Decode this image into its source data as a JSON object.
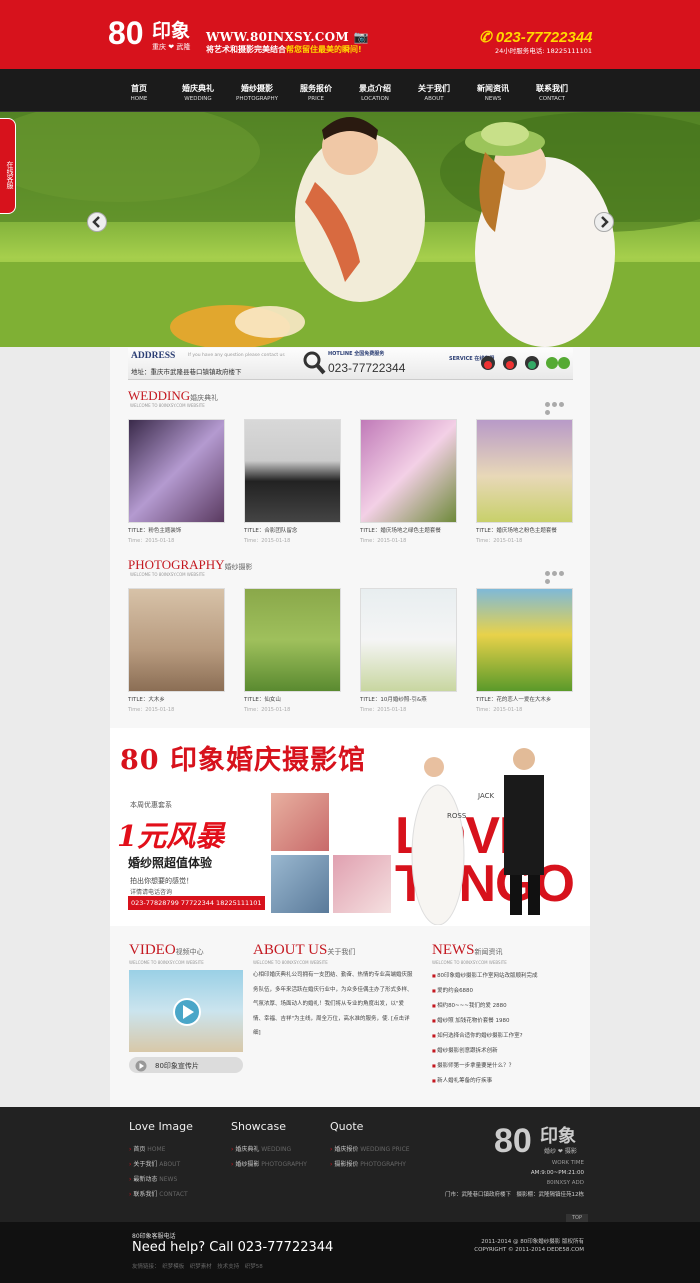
{
  "header": {
    "logo_text": "印象",
    "logo_sub": "重庆 ❤ 武隆",
    "url": "WWW.80INXSY.COM",
    "slogan_a": "将艺术和摄影完美结合",
    "slogan_b": "帮您留住最美的瞬间!",
    "phone": "023-77722344",
    "phone_sub": "24小时服务电话: 18225111101"
  },
  "nav": [
    {
      "cn": "首页",
      "en": "HOME"
    },
    {
      "cn": "婚庆典礼",
      "en": "WEDDING"
    },
    {
      "cn": "婚纱摄影",
      "en": "PHOTOGRAPHY"
    },
    {
      "cn": "服务报价",
      "en": "PRICE"
    },
    {
      "cn": "景点介绍",
      "en": "LOCATION"
    },
    {
      "cn": "关于我们",
      "en": "ABOUT"
    },
    {
      "cn": "新闻资讯",
      "en": "NEWS"
    },
    {
      "cn": "联系我们",
      "en": "CONTACT"
    }
  ],
  "side_tab": "在线客服",
  "address": {
    "title": "ADDRESS",
    "sub": "If you have any question please contact us",
    "line": "地址：重庆市武隆县巷口镇镇政府楼下",
    "hotline_label": "HOTLINE 全国免费服务",
    "hotline": "023-77722344",
    "service_label": "SERVICE 在线客服"
  },
  "wedding": {
    "title": "WEDDING",
    "title_cn": "婚庆典礼",
    "sub": "WELCOME TO 80INXSY.COM WEBSITE",
    "items": [
      {
        "title": "TITLE：粉色主题装饰",
        "time": "Time：2015-01-18"
      },
      {
        "title": "TITLE：合影团队留念",
        "time": "Time：2015-01-18"
      },
      {
        "title": "TITLE：婚庆场地之绿色主题套餐",
        "time": "Time：2015-01-18"
      },
      {
        "title": "TITLE：婚庆场地之粉色主题套餐",
        "time": "Time：2015-01-18"
      }
    ]
  },
  "photography": {
    "title": "PHOTOGRAPHY",
    "title_cn": "婚纱摄影",
    "sub": "WELCOME TO 80INXSY.COM WEBSITE",
    "items": [
      {
        "title": "TITLE：大木乡",
        "time": "Time：2015-01-18"
      },
      {
        "title": "TITLE：仙女山",
        "time": "Time：2015-01-18"
      },
      {
        "title": "TITLE：10月婚纱照-引&燕",
        "time": "Time：2015-01-18"
      },
      {
        "title": "TITLE：花的恋人一爱在大木乡",
        "time": "Time：2015-01-18"
      }
    ]
  },
  "ad": {
    "title": "80 印象婚庆摄影馆",
    "week": "本周优惠套系",
    "big": "1元风暴",
    "exp": "婚纱照超值体验",
    "feel": "拍出你想要的感觉！",
    "call": "详情请电话咨询",
    "tel": "023-77828799  77722344  18225111101",
    "lovetango": "LOVE TANGO",
    "jack": "JACK",
    "ross": "ROSS"
  },
  "video": {
    "title": "VIDEO",
    "title_cn": "视频中心",
    "sub": "WELCOME TO 80INXSY.COM WEBSITE",
    "button": "80印象宣传片"
  },
  "about": {
    "title": "ABOUT US",
    "title_cn": "关于我们",
    "sub": "WELCOME TO 80INXSY.COM WEBSITE",
    "text": "心相印婚庆典礼公司拥有一支团结、勤奋、热情的专业高端婚庆服务队伍，多年来活跃在婚庆行业中，为众多佳偶主办了形式多样、气氛浓厚、场面动人的婚礼！我们将从专业的角度出发，以\"爱情、幸福、吉祥\"为主线，周全万位，高水准的服务，使. [点击详细]"
  },
  "news": {
    "title": "NEWS",
    "title_cn": "新闻资讯",
    "sub": "WELCOME TO 80INXSY.COM WEBSITE",
    "items": [
      "80印象婚纱摄影工作室网站改版顺利完成",
      "爱的约会6880",
      "相约80~~~我们的爱 2880",
      "婚纱照 加钱花物价套餐 1980",
      "如何选择合适你的婚纱摄影工作室?",
      "婚纱摄影创意跟拆术创新",
      "摄影师第一步拿量要是什么？？",
      "新人婚礼筹备的疗疾事"
    ]
  },
  "footer": {
    "col1_title": "Love Image",
    "col1": [
      {
        "cn": "首页",
        "en": "HOME"
      },
      {
        "cn": "关于我们",
        "en": "ABOUT"
      },
      {
        "cn": "最新动态",
        "en": "NEWS"
      },
      {
        "cn": "联系我们",
        "en": "CONTACT"
      }
    ],
    "col2_title": "Showcase",
    "col2": [
      {
        "cn": "婚庆典礼",
        "en": "WEDDING"
      },
      {
        "cn": "婚纱摄影",
        "en": "PHOTOGRAPHY"
      }
    ],
    "col3_title": "Quote",
    "col3": [
      {
        "cn": "婚庆报价",
        "en": "WEDDING PRICE"
      },
      {
        "cn": "摄影报价",
        "en": "PHOTOGRAPHY"
      }
    ],
    "logo_text": "印象",
    "logo_sub": "婚纱 ❤ 摄影",
    "work_time": "WORK TIME",
    "hours": "AM:9:00~PM:21:00",
    "add_label": "80INXSY ADD",
    "store": "门市：武隆巷口镇政府楼下　摄影棚：武隆隔镇佳苑12栋",
    "top": "TOP"
  },
  "bottom": {
    "hotline_label": "80印象客服电话",
    "needhelp": "Need help?  Call 023-77722344",
    "links": "友情链接：　织梦模板　织梦素材　技术支持　织梦58",
    "copyright1": "2011-2014 @ 80印象婚纱摄影 版权所有",
    "copyright2": "COPYRIGHT © 2011-2014 DEDE58.COM"
  },
  "colors": {
    "brand_red": "#d7121c",
    "nav_bg": "#1b1b1b",
    "accent_yellow": "#ffd800"
  }
}
